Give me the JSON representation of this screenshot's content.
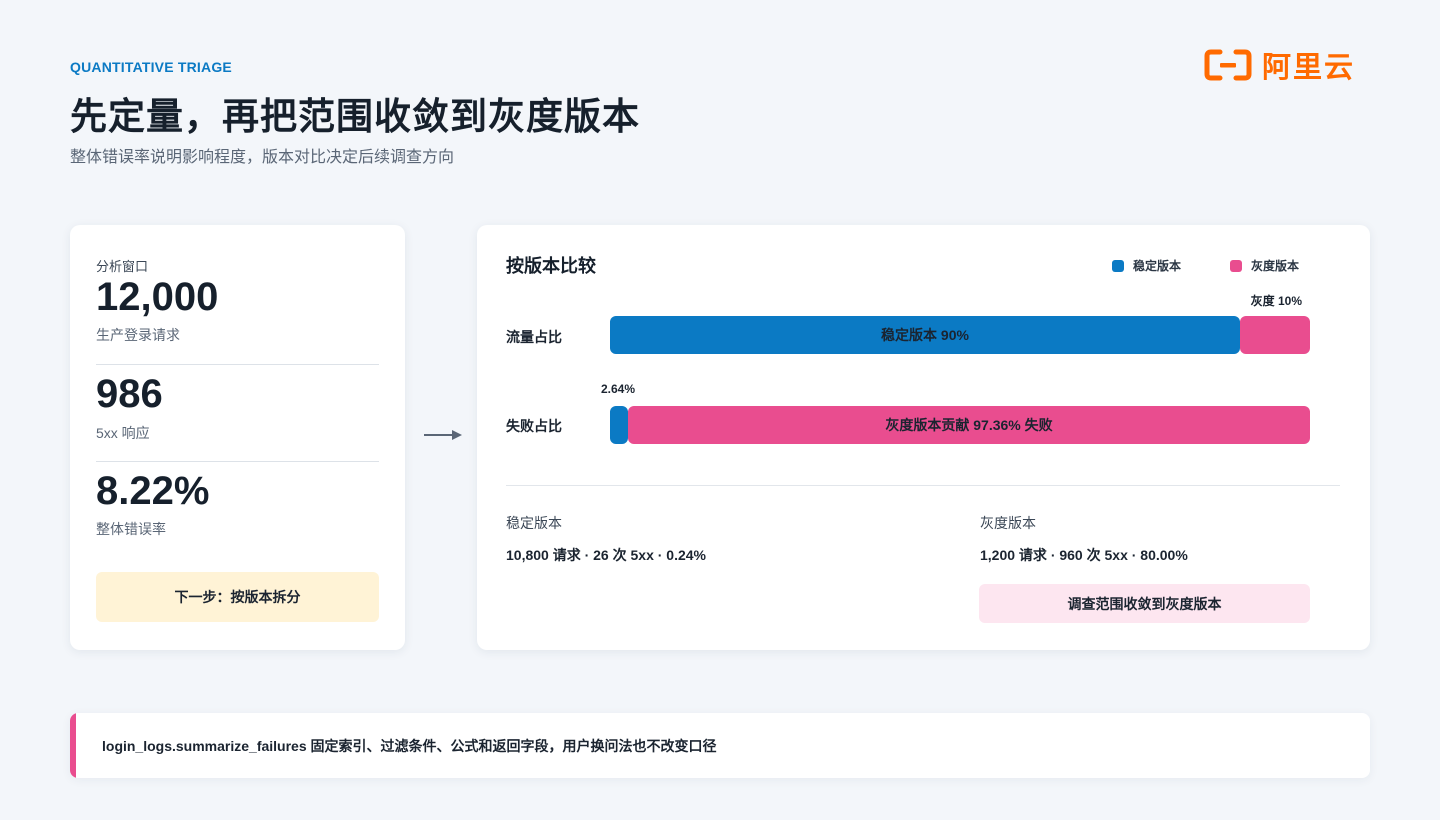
{
  "header": {
    "eyebrow": "QUANTITATIVE TRIAGE",
    "title": "先定量，再把范围收敛到灰度版本",
    "subtitle": "整体错误率说明影响程度，版本对比决定后续调查方向"
  },
  "logo": {
    "text": "阿里云",
    "color": "#ff6a00"
  },
  "summary": {
    "window_label": "分析窗口",
    "stats": [
      {
        "value": "12,000",
        "caption": "生产登录请求"
      },
      {
        "value": "986",
        "caption": "5xx 响应"
      },
      {
        "value": "8.22%",
        "caption": "整体错误率"
      }
    ],
    "next_step": "下一步：按版本拆分"
  },
  "comparison": {
    "title": "按版本比较",
    "legend": [
      {
        "label": "稳定版本",
        "color": "#0b7ac4"
      },
      {
        "label": "灰度版本",
        "color": "#e94d8f"
      }
    ],
    "traffic": {
      "label": "流量占比",
      "stable_share": 0.9,
      "canary_share": 0.1,
      "stable_label": "稳定版本 90%",
      "canary_label": "灰度 10%"
    },
    "failures": {
      "label": "失败占比",
      "stable_share": 0.0264,
      "canary_share": 0.9736,
      "stable_label": "2.64%",
      "canary_label": "灰度版本贡献 97.36% 失败"
    },
    "versions": [
      {
        "name": "稳定版本",
        "stats": "10,800 请求 · 26 次 5xx · 0.24%"
      },
      {
        "name": "灰度版本",
        "stats": "1,200 请求 · 960 次 5xx · 80.00%"
      }
    ],
    "action": "调查范围收敛到灰度版本"
  },
  "footer": {
    "note": "login_logs.summarize_failures 固定索引、过滤条件、公式和返回字段，用户换问法也不改变口径"
  },
  "colors": {
    "accent": "#0b7ac4",
    "stable": "#0b7ac4",
    "canary": "#e94d8f",
    "highlight": "#fff3d6"
  }
}
